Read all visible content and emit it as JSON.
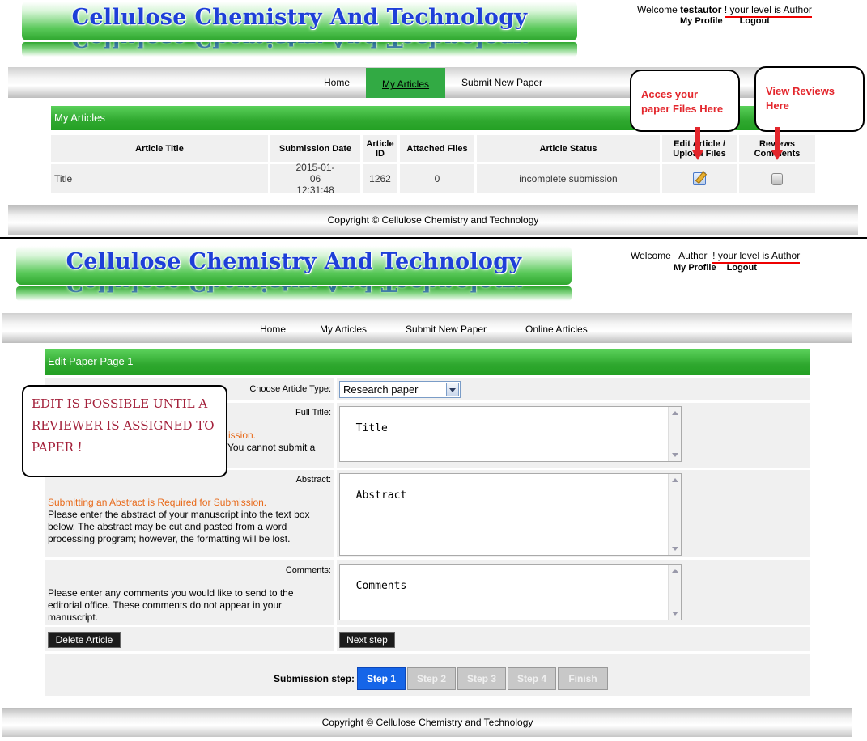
{
  "site_title": "Cellulose Chemistry And Technology",
  "top": {
    "welcome_prefix": "Welcome",
    "username": "testautor",
    "level_text": "! your level is Author",
    "my_profile": "My Profile",
    "logout": "Logout",
    "nav": {
      "home": "Home",
      "my_articles": "My Articles",
      "submit_new_paper": "Submit New Paper"
    },
    "section_title": "My Articles",
    "table": {
      "headers": {
        "title": "Article Title",
        "date": "Submission Date",
        "id": "Article ID",
        "files": "Attached Files",
        "status": "Article Status",
        "edit": "Edit Article / Upload Files",
        "reviews": "Reviews Comments"
      },
      "row": {
        "title": "Title",
        "date": "2015-01-06 12:31:48",
        "id": "1262",
        "files": "0",
        "status": "incomplete submission"
      }
    },
    "footer": "Copyright © Cellulose Chemistry and Technology",
    "callout_files": "Acces your paper Files Here",
    "callout_reviews": "View Reviews Here"
  },
  "bottom": {
    "welcome_prefix": "Welcome",
    "username": "Author",
    "level_text": "! your level is Author",
    "my_profile": "My Profile",
    "logout": "Logout",
    "nav": {
      "home": "Home",
      "my_articles": "My Articles",
      "submit_new_paper": "Submit New Paper",
      "online_articles": "Online Articles"
    },
    "section_title": "Edit Paper Page 1",
    "form": {
      "article_type_label": "Choose Article Type:",
      "article_type_value": "Research paper",
      "full_title_label": "Full Title:",
      "full_title_value": "Title",
      "title_req_partial": "ission.",
      "title_help_partial": "You cannot submit a",
      "abstract_label": "Abstract:",
      "abstract_value": "Abstract",
      "abstract_req": "Submitting an Abstract is Required for Submission.",
      "abstract_help": "Please enter the abstract of your manuscript into the text box below. The abstract may be cut and pasted from a word processing program; however, the formatting will be lost.",
      "comments_label": "Comments:",
      "comments_value": "Comments",
      "comments_help": "Please enter any comments you would like to send to the editorial office. These comments do not appear in your manuscript.",
      "delete_button": "Delete Article",
      "next_button": "Next step",
      "steps_label": "Submission step:",
      "steps": [
        "Step 1",
        "Step 2",
        "Step 3",
        "Step 4",
        "Finish"
      ]
    },
    "edit_callout": "EDIT IS POSSIBLE UNTIL A REVIEWER IS ASSIGNED TO PAPER !",
    "footer": "Copyright © Cellulose Chemistry and Technology"
  }
}
